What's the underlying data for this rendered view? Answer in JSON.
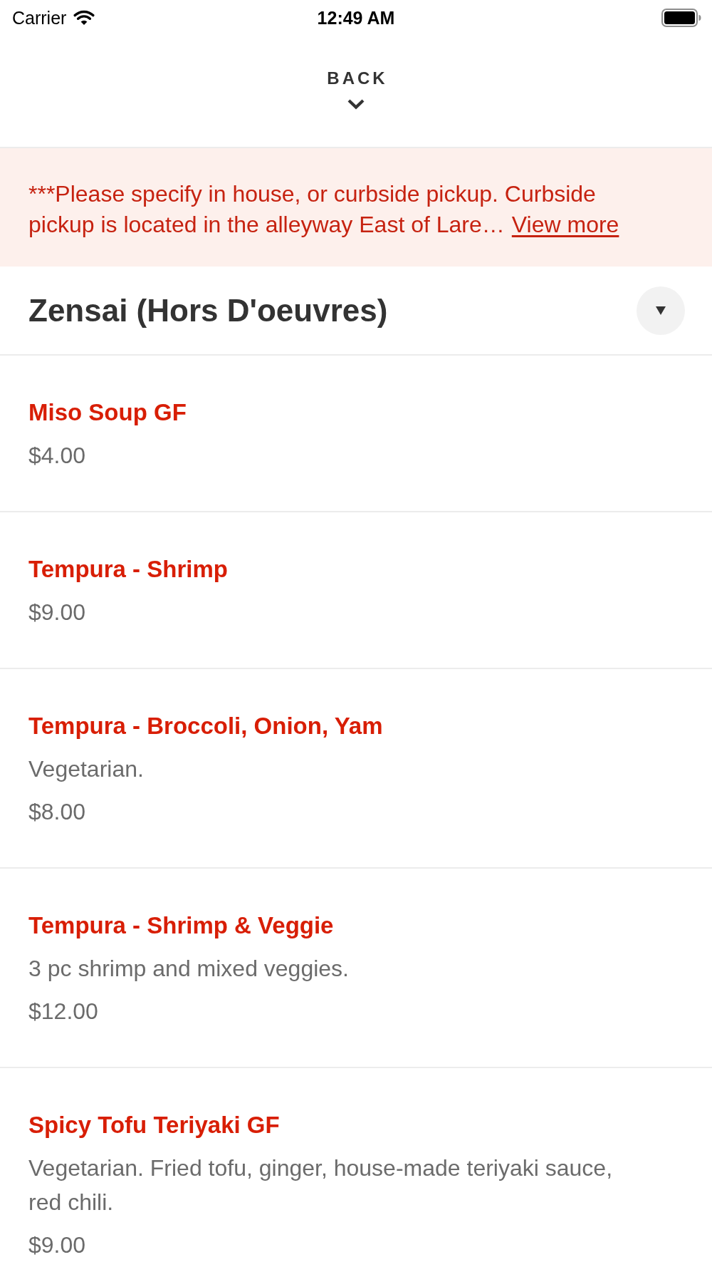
{
  "status_bar": {
    "carrier": "Carrier",
    "time": "12:49 AM"
  },
  "header": {
    "back_label": "BACK"
  },
  "notice": {
    "text": "***Please specify in house, or curbside pickup. Curbside pickup is located in the alleyway East of Lare…",
    "link": "View more"
  },
  "section": {
    "title": "Zensai (Hors D'oeuvres)"
  },
  "items": [
    {
      "name": "Miso Soup GF",
      "price": "$4.00"
    },
    {
      "name": "Tempura - Shrimp",
      "price": "$9.00"
    },
    {
      "name": "Tempura - Broccoli, Onion, Yam",
      "description": "Vegetarian.",
      "price": "$8.00"
    },
    {
      "name": "Tempura - Shrimp & Veggie",
      "description": "3 pc shrimp and mixed veggies.",
      "price": "$12.00"
    },
    {
      "name": "Spicy Tofu Teriyaki GF",
      "description": "Vegetarian. Fried tofu, ginger, house-made teriyaki sauce, red chili.",
      "price": "$9.00"
    }
  ]
}
